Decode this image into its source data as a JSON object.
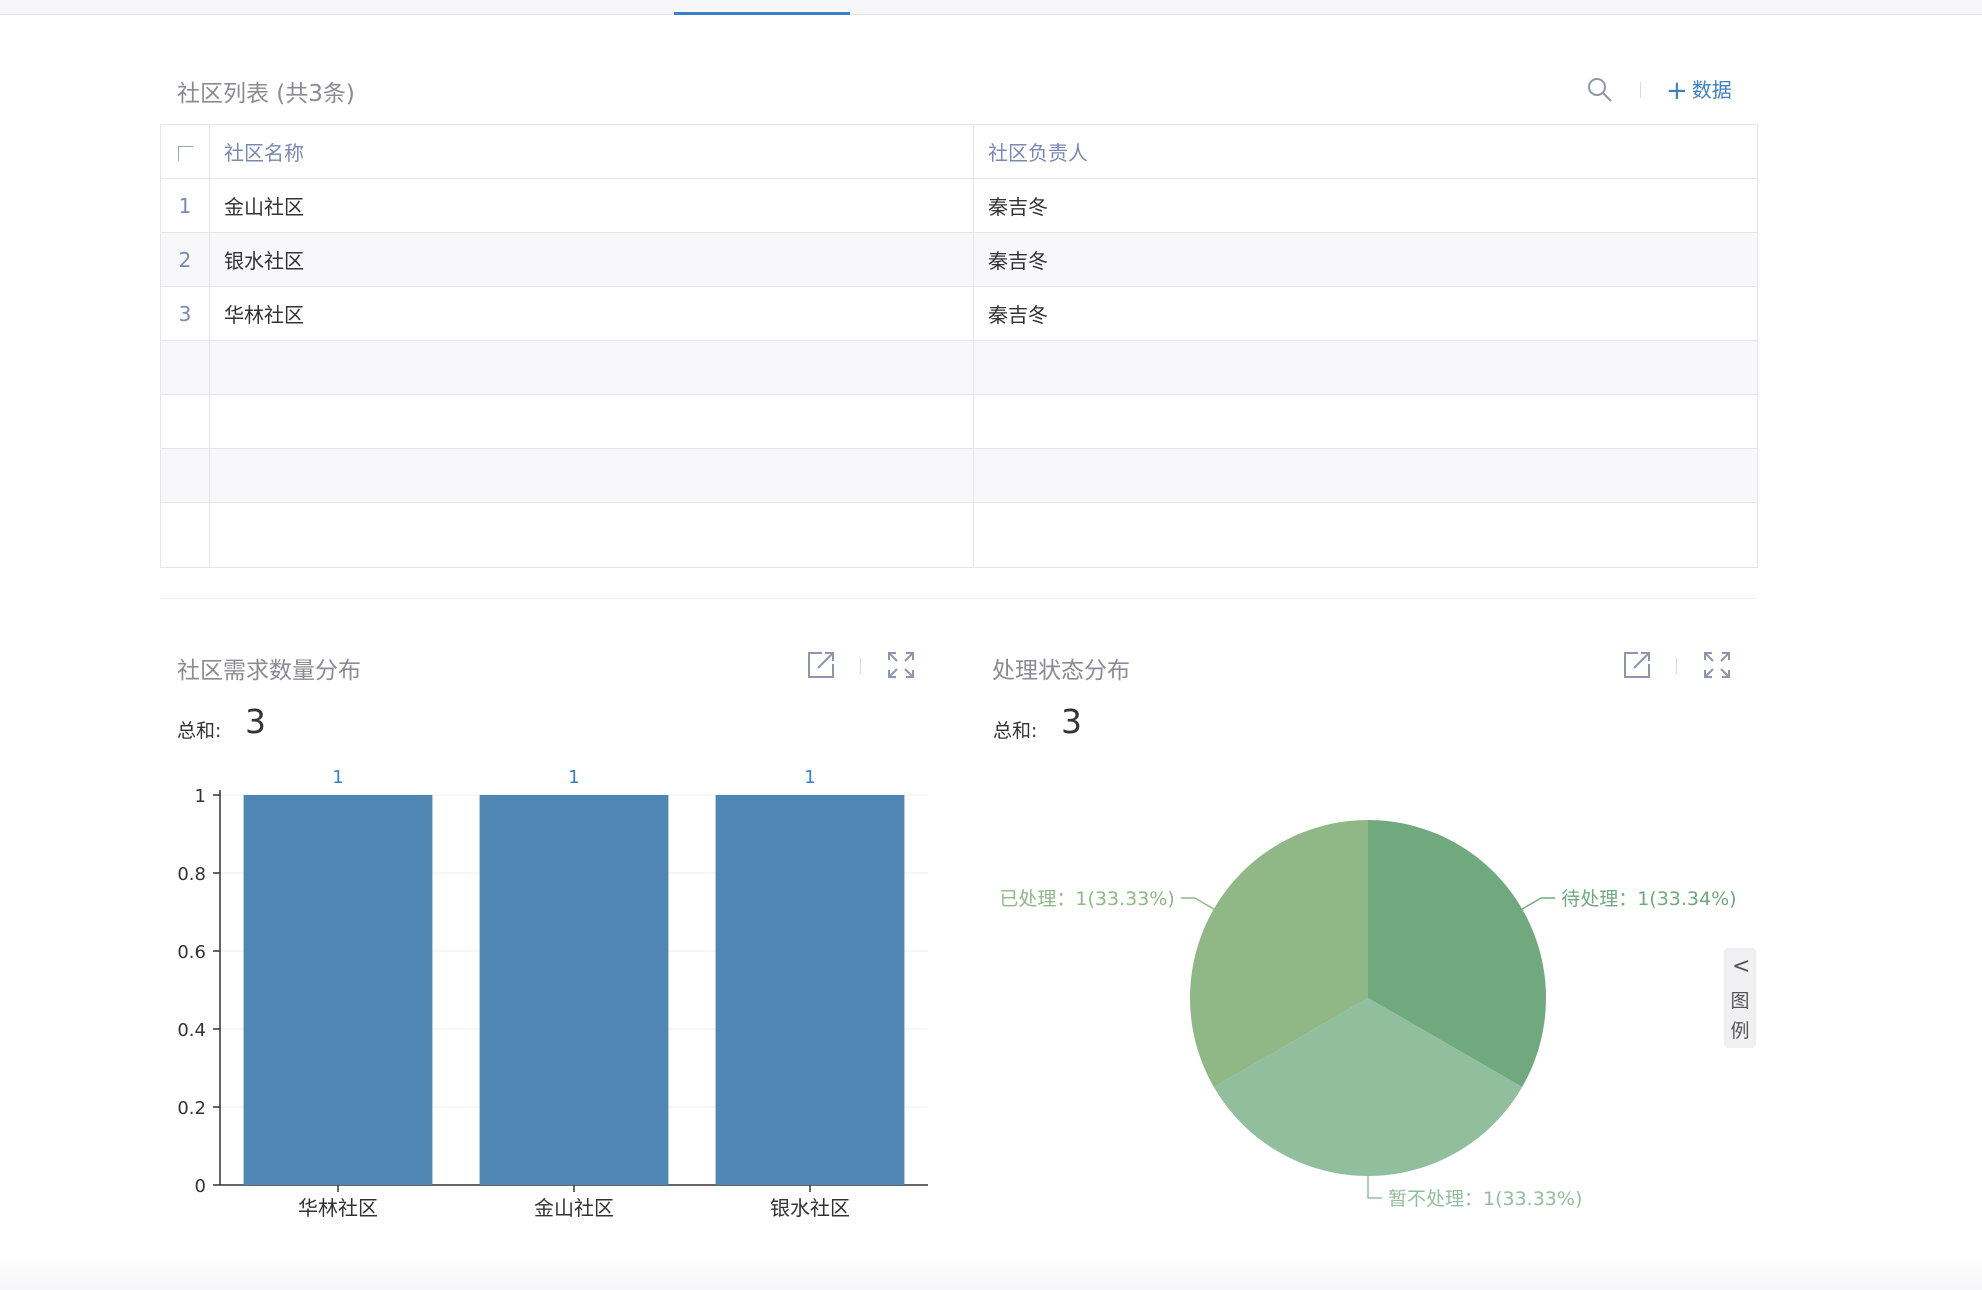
{
  "list": {
    "title": "社区列表 (共3条)",
    "add_label": "数据",
    "columns": [
      "社区名称",
      "社区负责人"
    ],
    "rows": [
      {
        "index": "1",
        "name": "金山社区",
        "owner": "秦吉冬"
      },
      {
        "index": "2",
        "name": "银水社区",
        "owner": "秦吉冬"
      },
      {
        "index": "3",
        "name": "华林社区",
        "owner": "秦吉冬"
      }
    ]
  },
  "bar_panel": {
    "title": "社区需求数量分布",
    "total_label": "总和:",
    "total_value": "3"
  },
  "pie_panel": {
    "title": "处理状态分布",
    "total_label": "总和:",
    "total_value": "3",
    "legend_tab": {
      "arrow": "<",
      "text": "图例"
    }
  },
  "colors": {
    "accent": "#3b7fc4",
    "bar": "#4f86b3",
    "pie": [
      "#71a97f",
      "#91bf9e",
      "#8fb886"
    ]
  },
  "chart_data": [
    {
      "type": "bar",
      "categories": [
        "华林社区",
        "金山社区",
        "银水社区"
      ],
      "values": [
        1,
        1,
        1
      ],
      "data_labels": [
        "1",
        "1",
        "1"
      ],
      "ylim": [
        0,
        1
      ],
      "yticks": [
        "0",
        "0.2",
        "0.4",
        "0.6",
        "0.8",
        "1"
      ],
      "grid": true
    },
    {
      "type": "pie",
      "slices": [
        {
          "name": "待处理",
          "value": 1,
          "label": "待处理：1(33.34%)"
        },
        {
          "name": "暂不处理",
          "value": 1,
          "label": "暂不处理：1(33.33%)"
        },
        {
          "name": "已处理",
          "value": 1,
          "label": "已处理：1(33.33%)"
        }
      ]
    }
  ]
}
